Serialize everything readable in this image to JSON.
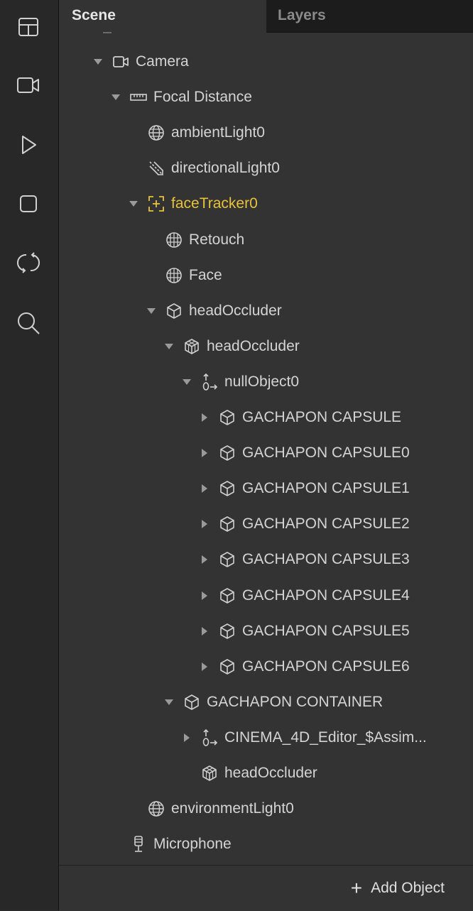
{
  "tabs": {
    "scene": "Scene",
    "layers": "Layers"
  },
  "rail": [
    {
      "name": "layout-icon"
    },
    {
      "name": "video-camera-icon"
    },
    {
      "name": "play-icon"
    },
    {
      "name": "stop-icon"
    },
    {
      "name": "refresh-icon"
    },
    {
      "name": "search-icon"
    }
  ],
  "tree": [
    {
      "label": "Camera",
      "depth": 0,
      "arrow": "down",
      "icon": "camera"
    },
    {
      "label": "Focal Distance",
      "depth": 1,
      "arrow": "down",
      "icon": "ruler"
    },
    {
      "label": "ambientLight0",
      "depth": 2,
      "arrow": "none",
      "icon": "globe"
    },
    {
      "label": "directionalLight0",
      "depth": 2,
      "arrow": "none",
      "icon": "directional"
    },
    {
      "label": "faceTracker0",
      "depth": 2,
      "arrow": "down",
      "icon": "facetracker",
      "selected": true
    },
    {
      "label": "Retouch",
      "depth": 3,
      "arrow": "none",
      "icon": "mesh"
    },
    {
      "label": "Face",
      "depth": 3,
      "arrow": "none",
      "icon": "mesh"
    },
    {
      "label": "headOccluder",
      "depth": 3,
      "arrow": "down",
      "icon": "cube"
    },
    {
      "label": "headOccluder",
      "depth": 4,
      "arrow": "down",
      "icon": "cube3d"
    },
    {
      "label": "nullObject0",
      "depth": 5,
      "arrow": "down",
      "icon": "null"
    },
    {
      "label": "GACHAPON CAPSULE",
      "depth": 6,
      "arrow": "right",
      "icon": "cube"
    },
    {
      "label": "GACHAPON CAPSULE0",
      "depth": 6,
      "arrow": "right",
      "icon": "cube"
    },
    {
      "label": "GACHAPON CAPSULE1",
      "depth": 6,
      "arrow": "right",
      "icon": "cube"
    },
    {
      "label": "GACHAPON CAPSULE2",
      "depth": 6,
      "arrow": "right",
      "icon": "cube"
    },
    {
      "label": "GACHAPON CAPSULE3",
      "depth": 6,
      "arrow": "right",
      "icon": "cube"
    },
    {
      "label": "GACHAPON CAPSULE4",
      "depth": 6,
      "arrow": "right",
      "icon": "cube"
    },
    {
      "label": "GACHAPON CAPSULE5",
      "depth": 6,
      "arrow": "right",
      "icon": "cube"
    },
    {
      "label": "GACHAPON CAPSULE6",
      "depth": 6,
      "arrow": "right",
      "icon": "cube"
    },
    {
      "label": "GACHAPON CONTAINER",
      "depth": 4,
      "arrow": "down",
      "icon": "cube"
    },
    {
      "label": "CINEMA_4D_Editor_$Assim...",
      "depth": 5,
      "arrow": "right",
      "icon": "null"
    },
    {
      "label": "headOccluder",
      "depth": 5,
      "arrow": "none",
      "icon": "cube3d"
    },
    {
      "label": "environmentLight0",
      "depth": 2,
      "arrow": "none",
      "icon": "globe"
    },
    {
      "label": "Microphone",
      "depth": 1,
      "arrow": "none",
      "icon": "microphone"
    }
  ],
  "footer": {
    "add_object_label": "Add Object"
  },
  "colors": {
    "selected": "#e8c23a",
    "panel": "#333333",
    "rail": "#282828",
    "tab_inactive": "#1c1c1c"
  }
}
